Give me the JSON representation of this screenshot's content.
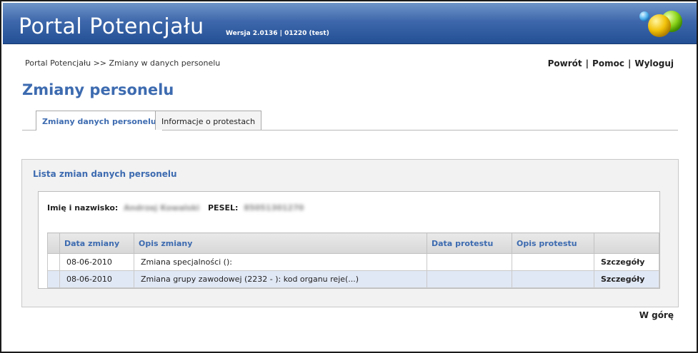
{
  "header": {
    "app_title": "Portal Potencjału",
    "version": "Wersja 2.0136 | 01220 (test)",
    "colors": {
      "bar_top": "#6f95c9",
      "bar_bottom": "#234f95",
      "accent": "#3d6bb0"
    }
  },
  "breadcrumb": "Portal Potencjału >> Zmiany w danych personelu",
  "toplinks": {
    "back": "Powrót",
    "help": "Pomoc",
    "logout": "Wyloguj"
  },
  "page_title": "Zmiany personelu",
  "tabs": [
    {
      "label": "Zmiany danych personelu",
      "active": true
    },
    {
      "label": "Informacje o protestach",
      "active": false
    }
  ],
  "panel": {
    "title": "Lista zmian danych personelu",
    "person": {
      "name_label": "Imię i nazwisko:",
      "name_value": "Andrzej Kowalski",
      "pesel_label": "PESEL:",
      "pesel_value": "85051301270"
    },
    "table": {
      "columns": [
        "Data zmiany",
        "Opis zmiany",
        "Data protestu",
        "Opis protestu",
        ""
      ],
      "rows": [
        {
          "date": "08-06-2010",
          "description": "Zmiana specjalności ():",
          "protest_date": "",
          "protest_desc": "",
          "action": "Szczegóły"
        },
        {
          "date": "08-06-2010",
          "description": "Zmiana grupy zawodowej (2232 - ): kod organu reje(...)",
          "protest_date": "",
          "protest_desc": "",
          "action": "Szczegóły"
        }
      ]
    }
  },
  "to_top": "W górę"
}
